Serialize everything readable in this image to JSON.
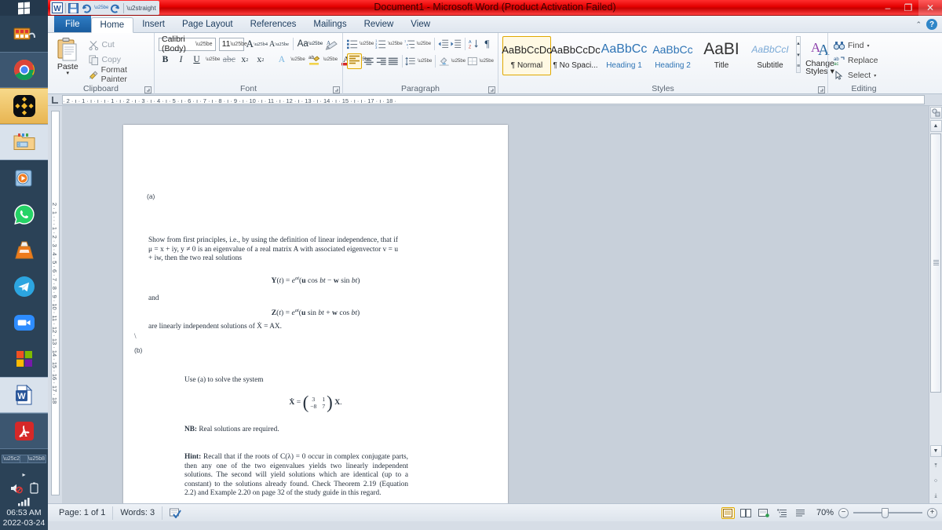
{
  "titlebar": {
    "title": "Document1  -  Microsoft Word (Product Activation Failed)",
    "quick_access": [
      "word-icon",
      "save-icon",
      "undo-icon",
      "redo-icon",
      "customize-icon"
    ],
    "minimize": "–",
    "restore": "❐",
    "close": "✕"
  },
  "tabs": [
    {
      "label": "File",
      "kind": "file"
    },
    {
      "label": "Home",
      "kind": "active"
    },
    {
      "label": "Insert",
      "kind": "normal"
    },
    {
      "label": "Page Layout",
      "kind": "normal"
    },
    {
      "label": "References",
      "kind": "normal"
    },
    {
      "label": "Mailings",
      "kind": "normal"
    },
    {
      "label": "Review",
      "kind": "normal"
    },
    {
      "label": "View",
      "kind": "normal"
    }
  ],
  "tabbar_right": {
    "collapse": "⌃",
    "help": "?"
  },
  "ribbon": {
    "clipboard": {
      "group_label": "Clipboard",
      "paste": "Paste",
      "paste_arrow": "▾",
      "cut": "Cut",
      "copy": "Copy",
      "format_painter": "Format Painter"
    },
    "font": {
      "group_label": "Font",
      "font_name": "Calibri (Body)",
      "font_size": "11",
      "grow_font": "A",
      "shrink_font": "A",
      "change_case": "Aa",
      "clear_formatting": "clear-formatting-icon",
      "bold": "B",
      "italic": "I",
      "underline": "U",
      "strikethrough": "abc",
      "subscript": "x",
      "subscript_idx": "2",
      "superscript": "x",
      "superscript_idx": "2",
      "text_effects": "A",
      "highlight": "ab",
      "font_color": "A"
    },
    "paragraph": {
      "group_label": "Paragraph",
      "bullets": "bullets-icon",
      "numbering": "numbering-icon",
      "multilevel": "multilevel-list-icon",
      "decrease_indent": "decrease-indent-icon",
      "increase_indent": "increase-indent-icon",
      "sort": "sort-icon",
      "show_marks": "¶",
      "align_left": "align-left-icon",
      "align_center": "align-center-icon",
      "align_right": "align-right-icon",
      "justify": "justify-icon",
      "line_spacing": "line-spacing-icon",
      "shading": "shading-icon",
      "borders": "borders-icon"
    },
    "styles": {
      "group_label": "Styles",
      "items": [
        {
          "preview": "AaBbCcDc",
          "name": "¶ Normal",
          "selected": true,
          "color": "#1f1f1f",
          "size": "13px"
        },
        {
          "preview": "AaBbCcDc",
          "name": "¶ No Spaci...",
          "selected": false,
          "color": "#1f1f1f",
          "size": "13px"
        },
        {
          "preview": "AaBbCс",
          "name": "Heading 1",
          "selected": false,
          "color": "#2e74b5",
          "size": "16px"
        },
        {
          "preview": "AaBbCc",
          "name": "Heading 2",
          "selected": false,
          "color": "#2e74b5",
          "size": "14px"
        },
        {
          "preview": "AaBІ",
          "name": "Title",
          "selected": false,
          "color": "#333333",
          "size": "20px"
        },
        {
          "preview": "AaBbCcI",
          "name": "Subtitle",
          "selected": false,
          "color": "#6fa8dc",
          "size": "12px"
        }
      ],
      "scroll": [
        "▴",
        "▾",
        "≡"
      ],
      "change_styles": "Change\nStyles",
      "change_styles_l1": "Change",
      "change_styles_l2": "Styles ▾"
    },
    "editing": {
      "group_label": "Editing",
      "find": "Find",
      "find_arrow": "▾",
      "replace": "Replace",
      "select": "Select",
      "select_arrow": "▾"
    }
  },
  "ruler": {
    "corner": "⌐",
    "horizontal": "· 2 · ı · 1 · ı · ı · ı · 1 · ı · 2 · ı · 3 · ı · 4 · ı · 5 · ı · 6 · ı · 7 · ı · 8 · ı · 9 · ı · 10 · ı · 11 · ı · 12 · ı · 13 · ı · 14 · ı · 15 · ı · ı · 17 · ı · 18 ·",
    "vertical": "2 · 1 · · · 1 · 2 · 3 · 4 · 5 · 6 · 7 · 8 · 9 · 10 · 11 · 12 · 13 · 14 · 15 · 16 · 17 · 18"
  },
  "document": {
    "label_a": "(a)",
    "para1": "Show from first principles, i.e., by using the definition of linear independence, that if μ = x + iy, y ≠ 0 is an eigenvalue of a real matrix A with associated eigenvector v = u + iw, then the two real solutions",
    "eq_Y": "Y(t) = eᵃᵗ(u cos bt − w sin bt)",
    "and_word": "and",
    "eq_Z": "Z(t) = eᵃᵗ(u sin bt + w cos bt)",
    "para2": "are linearly independent solutions of Ẋ = AX.",
    "backslash": "\\",
    "label_b": "(b)",
    "para3": "Use (a) to solve the system",
    "matrix_eq_lhs": "Ẋ =",
    "matrix_rows": [
      [
        "3",
        "1"
      ],
      [
        "−8",
        "7"
      ]
    ],
    "matrix_eq_rhs": "X.",
    "nb_label": "NB:",
    "nb_text": " Real solutions are required.",
    "hint_label": "Hint:",
    "hint_text": " Recall that if the roots of C(λ) = 0 occur in complex conjugate parts, then any one of the two eigenvalues yields two linearly independent solutions. The second will yield solutions which are identical (up to a constant) to the solutions already found. Check Theorem 2.19 (Equation 2.2) and Example 2.20 on page 32 of the study guide in this regard."
  },
  "scrollbar": {
    "select_browse_object": "select-browse-object-icon",
    "up": "▲",
    "down": "▼",
    "prev_page": "⤒",
    "browse": "○",
    "next_page": "⤓"
  },
  "statusbar": {
    "page": "Page: 1 of 1",
    "words": "Words: 3",
    "proofing": "proofing-errors-icon",
    "views": [
      "print-layout-icon",
      "full-screen-reading-icon",
      "web-layout-icon",
      "outline-icon",
      "draft-icon"
    ],
    "zoom": "70%",
    "zoom_out": "−",
    "zoom_in": "+"
  },
  "taskbar": {
    "start": "windows-start-icon",
    "items": [
      {
        "name": "media-film-icon",
        "state": "normal"
      },
      {
        "name": "chrome-icon",
        "state": "open"
      },
      {
        "name": "binance-icon",
        "state": "hot"
      },
      {
        "name": "file-explorer-icon",
        "state": "open2"
      },
      {
        "name": "media-player-icon",
        "state": "normal"
      },
      {
        "name": "whatsapp-icon",
        "state": "normal"
      },
      {
        "name": "vlc-icon",
        "state": "normal"
      },
      {
        "name": "telegram-icon",
        "state": "normal"
      },
      {
        "name": "zoom-app-icon",
        "state": "normal"
      },
      {
        "name": "microsoft-store-icon",
        "state": "normal"
      },
      {
        "name": "word-taskbar-icon",
        "state": "open2"
      },
      {
        "name": "acrobat-icon",
        "state": "open"
      }
    ],
    "tray": {
      "overflow": "▸",
      "volume": "volume-muted-icon",
      "battery": "battery-icon",
      "network": "signal-bars-icon",
      "time": "06:53 AM",
      "date": "2022-03-24"
    }
  }
}
